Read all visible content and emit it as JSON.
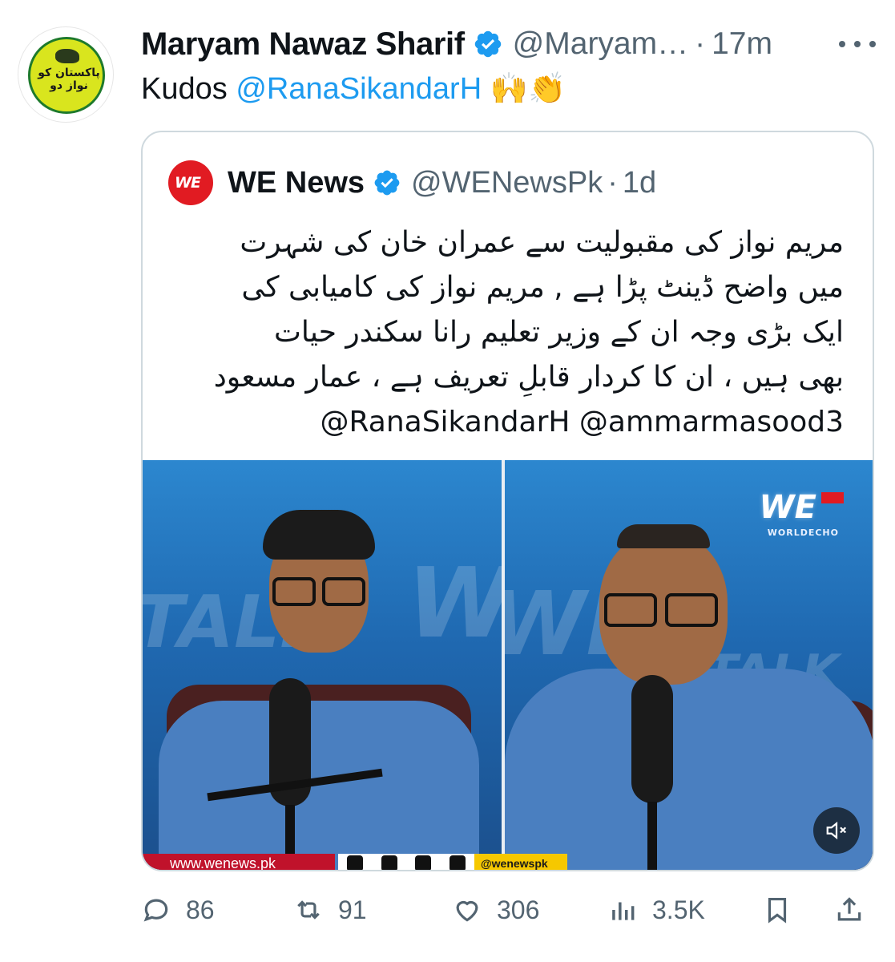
{
  "author": {
    "name": "Maryam Nawaz Sharif",
    "handle": "@Maryam…",
    "separator": "·",
    "time": "17m",
    "avatar_text": "پاکستان کو نواز دو"
  },
  "tweet": {
    "prefix": "Kudos ",
    "mention": "@RanaSikandarH",
    "emoji": "🙌👏"
  },
  "quote": {
    "avatar_text": "WE",
    "name": "WE News",
    "handle": "@WENewsPk",
    "separator": "·",
    "time": "1d",
    "lines": [
      "مریم نواز کی مقبولیت سے عمران خان کی شہرت",
      "میں  واضح ڈینٹ پڑا ہے , مریم نواز کی کامیابی کی",
      "ایک بڑی وجہ ان کے وزیر تعلیم رانا سکندر حیات",
      "بھی ہیں ، ان کا  کردار قابلِ تعریف ہے ، عمار مسعود"
    ],
    "mentions": "@RanaSikandarH @ammarmasood3"
  },
  "media": {
    "bg_word_1": "TALK",
    "bg_word_2": "WE",
    "logo": "WE",
    "logo_sub": "WORLDECHO",
    "footer_url": "www.wenews.pk",
    "footer_handle": "@wenewspk"
  },
  "actions": {
    "replies": "86",
    "reposts": "91",
    "likes": "306",
    "views": "3.5K"
  },
  "colors": {
    "accent": "#1d9bf0",
    "muted": "#536471",
    "we_red": "#e11b22"
  }
}
